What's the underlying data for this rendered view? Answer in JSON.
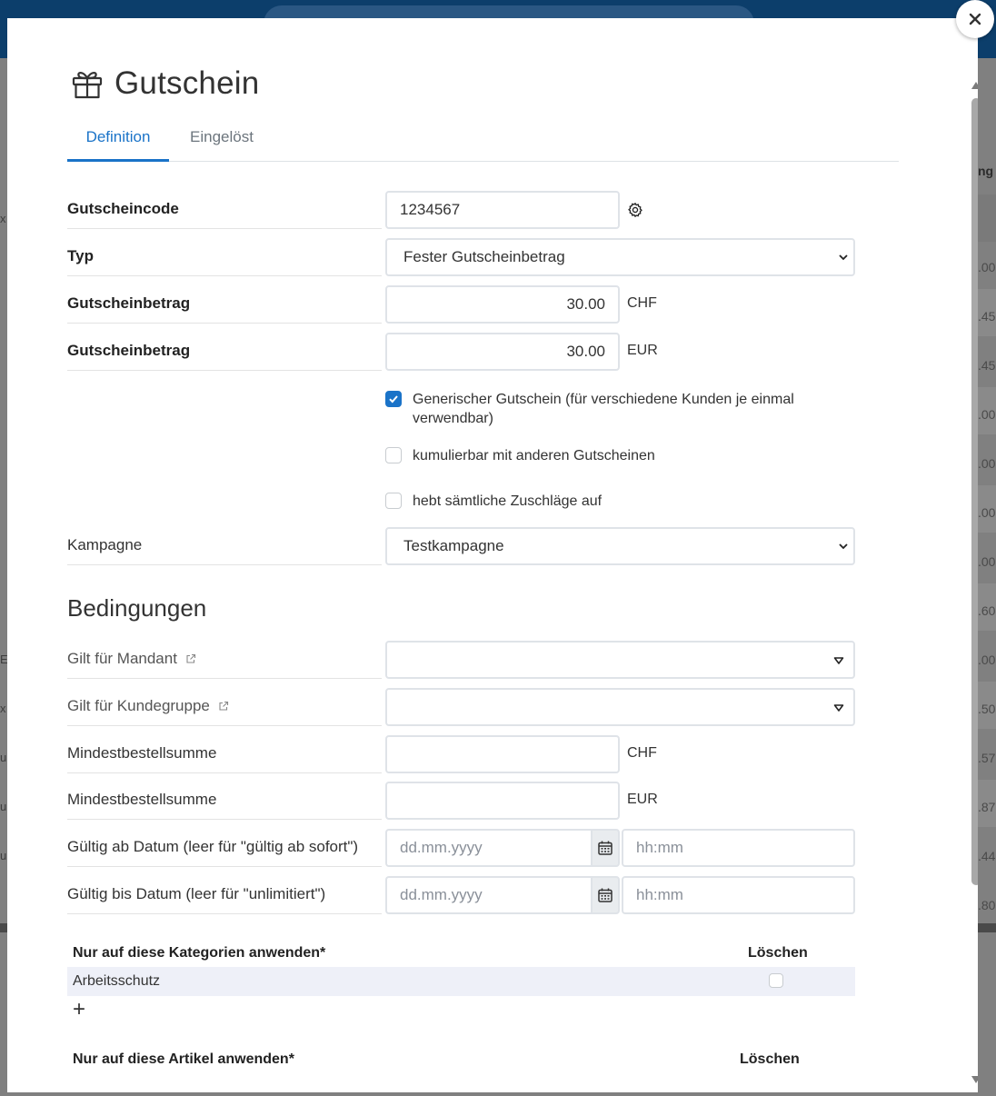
{
  "modal": {
    "title": "Gutschein",
    "tabs": [
      {
        "label": "Definition"
      },
      {
        "label": "Eingelöst"
      }
    ]
  },
  "form": {
    "code": {
      "label": "Gutscheincode",
      "value": "1234567"
    },
    "type": {
      "label": "Typ",
      "value": "Fester Gutscheinbetrag"
    },
    "amount_chf": {
      "label": "Gutscheinbetrag",
      "value": "30.00",
      "unit": "CHF"
    },
    "amount_eur": {
      "label": "Gutscheinbetrag",
      "value": "30.00",
      "unit": "EUR"
    },
    "generic": {
      "label": "Generischer Gutschein (für verschiedene Kunden je einmal verwendbar)",
      "checked": true
    },
    "cumulative": {
      "label": "kumulierbar mit anderen Gutscheinen",
      "checked": false
    },
    "override": {
      "label": "hebt sämtliche Zuschläge auf",
      "checked": false
    },
    "campaign": {
      "label": "Kampagne",
      "value": "Testkampagne"
    }
  },
  "conditions": {
    "title": "Bedingungen",
    "mandant": {
      "label": "Gilt für Mandant",
      "value": ""
    },
    "customer_group": {
      "label": "Gilt für Kundegruppe",
      "value": ""
    },
    "min_chf": {
      "label": "Mindestbestellsumme",
      "value": "",
      "unit": "CHF"
    },
    "min_eur": {
      "label": "Mindestbestellsumme",
      "value": "",
      "unit": "EUR"
    },
    "valid_from": {
      "label": "Gültig ab Datum (leer für \"gültig ab sofort\")",
      "date_placeholder": "dd.mm.yyyy",
      "time_placeholder": "hh:mm"
    },
    "valid_to": {
      "label": "Gültig bis Datum (leer für \"unlimitiert\")",
      "date_placeholder": "dd.mm.yyyy",
      "time_placeholder": "hh:mm"
    }
  },
  "categories": {
    "header": "Nur auf diese Kategorien anwenden*",
    "delete_header": "Löschen",
    "rows": [
      {
        "name": "Arbeitsschutz",
        "delete": false
      }
    ],
    "add_label": "+"
  },
  "articles": {
    "header": "Nur auf diese Artikel anwenden*",
    "delete_header": "Löschen"
  },
  "background": {
    "right_header": "ng",
    "right_values": [
      ".00",
      ".45",
      ".45",
      ".00",
      ".00",
      ".00",
      ".00",
      ".60",
      ".00",
      ".50",
      ".57",
      ".87",
      ".44",
      ".80"
    ],
    "left_chars": [
      "x",
      "",
      "",
      "",
      "",
      "E",
      "x",
      "u",
      "u",
      "u"
    ]
  },
  "colors": {
    "accent": "#1a73c8",
    "header_bg": "#0c3e6b"
  }
}
